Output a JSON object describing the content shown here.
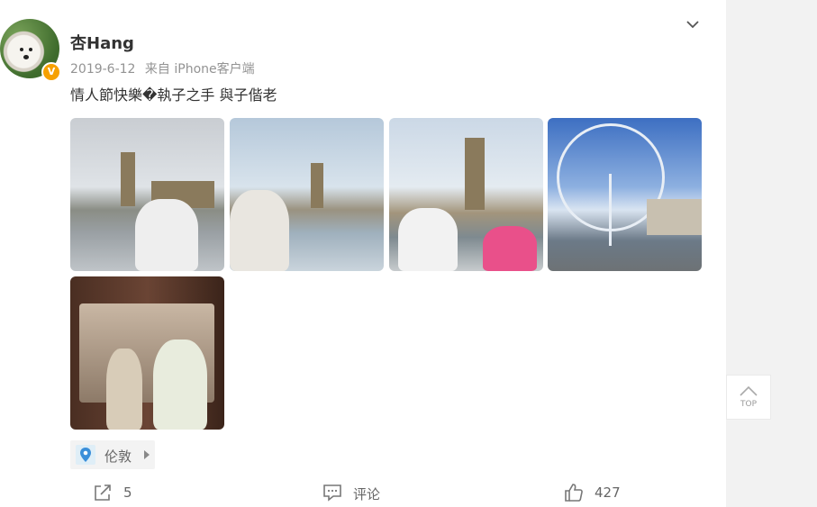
{
  "post": {
    "username": "杏Hang",
    "verified_badge": "V",
    "date": "2019-6-12",
    "source": "来自 iPhone客户端",
    "text": "情人節快樂�執子之手 與子偕老",
    "location": "伦敦"
  },
  "actions": {
    "share_count": "5",
    "comment_label": "评论",
    "like_count": "427"
  },
  "side": {
    "top_label": "TOP"
  },
  "colors": {
    "badge": "#f6a100",
    "text_main": "#333333",
    "text_meta": "#939393",
    "side_bg": "#f2f2f2"
  }
}
